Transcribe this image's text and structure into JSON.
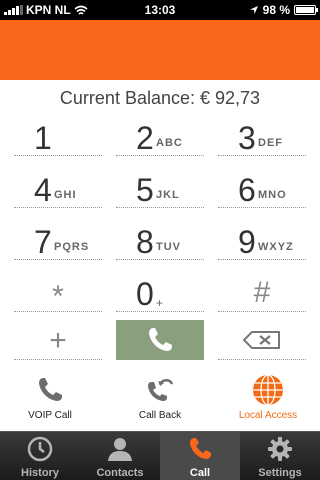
{
  "status_bar": {
    "carrier": "KPN NL",
    "time": "13:03",
    "battery_percent": "98 %",
    "battery_level": 0.98,
    "icons": [
      "signal-icon",
      "wifi-icon",
      "location-arrow-icon",
      "battery-icon"
    ]
  },
  "colors": {
    "brand_orange": "#f8671b",
    "call_button": "#8a9f7d",
    "local_access_text": "#f26a13"
  },
  "balance": {
    "label": "Current Balance: € 92,73"
  },
  "keypad": {
    "keys": [
      {
        "digit": "1",
        "letters": ""
      },
      {
        "digit": "2",
        "letters": "ABC"
      },
      {
        "digit": "3",
        "letters": "DEF"
      },
      {
        "digit": "4",
        "letters": "GHI"
      },
      {
        "digit": "5",
        "letters": "JKL"
      },
      {
        "digit": "6",
        "letters": "MNO"
      },
      {
        "digit": "7",
        "letters": "PQRS"
      },
      {
        "digit": "8",
        "letters": "TUV"
      },
      {
        "digit": "9",
        "letters": "WXYZ"
      },
      {
        "digit": "*",
        "letters": ""
      },
      {
        "digit": "0",
        "letters": "+"
      },
      {
        "digit": "#",
        "letters": ""
      }
    ],
    "bottom_row": {
      "plus": "+"
    }
  },
  "actions": {
    "voip_call": "VOIP Call",
    "call_back": "Call Back",
    "local_access": "Local Access"
  },
  "tabs": {
    "history": "History",
    "contacts": "Contacts",
    "call": "Call",
    "settings": "Settings",
    "active": "call"
  }
}
